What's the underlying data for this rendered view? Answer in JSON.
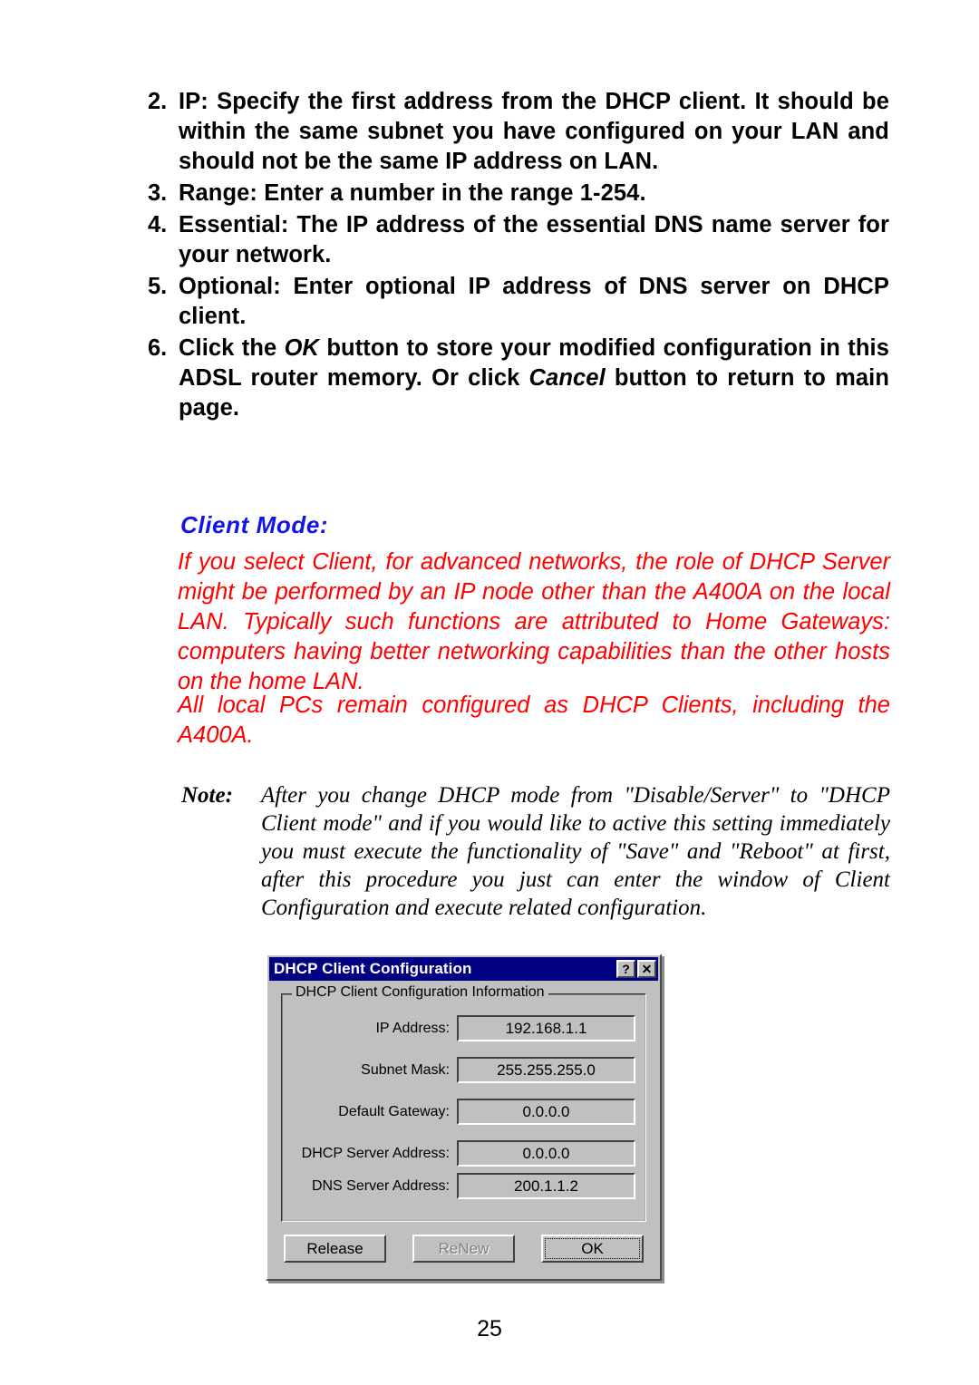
{
  "page": {
    "number": "25"
  },
  "instructions": [
    {
      "marker": "2.",
      "text": "IP: Specify the first address from the DHCP client.  It should be within the same subnet you have configured on your LAN and should not be the same IP address on LAN."
    },
    {
      "marker": "3.",
      "text": "Range: Enter a number in the range 1-254."
    },
    {
      "marker": "4.",
      "text": "Essential: The IP address of the essential DNS name server for your network."
    },
    {
      "marker": "5.",
      "text": "Optional: Enter optional IP address of DNS server on DHCP client."
    }
  ],
  "instruction_six": {
    "marker": "6.",
    "part1": "Click the ",
    "em1": "OK",
    "part2": " button to store your modified configuration in this ADSL router memory.  Or click ",
    "em2": "Cancel",
    "part3": " button to return to main page."
  },
  "client_mode": {
    "heading": "Client  Mode:",
    "heading_color": "#1414e6",
    "body_color": "#ff0000",
    "paragraph1": "If you select Client, for advanced networks, the role of DHCP Server might be performed by an IP node other than the A400A on the local LAN.  Typically such functions are attributed to Home Gateways: computers having better networking capabilities than the other hosts on the home LAN.",
    "paragraph2": "All local PCs remain configured as DHCP Clients, including the A400A."
  },
  "note": {
    "label": "Note:",
    "text": "After you change DHCP mode from \"Disable/Server\" to \"DHCP Client mode\" and if you would like to active this setting immediately you must execute the functionality of \"Save\" and \"Reboot\" at first, after this procedure you just can enter the window of Client Configuration and execute related configuration."
  },
  "dialog": {
    "title": "DHCP Client Configuration",
    "titlebar_color": "#000080",
    "face_color": "#c0c0c0",
    "help_button": "?",
    "close_button": "✕",
    "group_legend": "DHCP Client Configuration Information",
    "fields": [
      {
        "label": "IP Address:",
        "value": "192.168.1.1"
      },
      {
        "label": "Subnet Mask:",
        "value": "255.255.255.0"
      },
      {
        "label": "Default Gateway:",
        "value": "0.0.0.0"
      },
      {
        "label": "DHCP Server Address:",
        "value": "0.0.0.0"
      },
      {
        "label": "DNS Server Address:",
        "value": "200.1.1.2"
      }
    ],
    "buttons": [
      {
        "label": "Release",
        "state": "enabled"
      },
      {
        "label": "ReNew",
        "state": "disabled"
      },
      {
        "label": "OK",
        "state": "default"
      }
    ]
  }
}
